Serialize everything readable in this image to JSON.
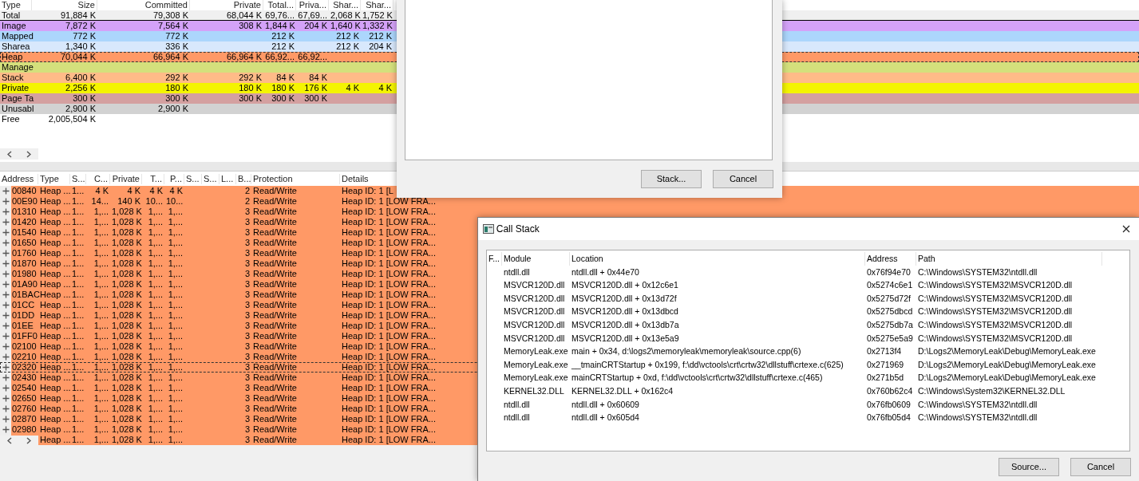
{
  "memory_summary": {
    "columns": [
      "Type",
      "Size",
      "Committed",
      "Private",
      "Total...",
      "Priva...",
      "Shar...",
      "Shar..."
    ],
    "rows": [
      {
        "cells": [
          "Total",
          "91,884 K",
          "79,308 K",
          "68,044 K",
          "69,76...",
          "67,69...",
          "2,068 K",
          "1,752 K"
        ],
        "color": "#f0f0f0",
        "focused": false
      },
      {
        "cells": [
          "Image",
          "7,872 K",
          "7,564 K",
          "308 K",
          "1,844 K",
          "204 K",
          "1,640 K",
          "1,332 K"
        ],
        "color": "#d4a2f8",
        "focused": false
      },
      {
        "cells": [
          "Mapped",
          "772 K",
          "772 K",
          null,
          "212 K",
          null,
          "212 K",
          "212 K"
        ],
        "color": "#acd6fc",
        "focused": false
      },
      {
        "cells": [
          "Sharea",
          "1,340 K",
          "336 K",
          null,
          "212 K",
          null,
          "212 K",
          "204 K"
        ],
        "color": "#d8e8fc",
        "focused": false
      },
      {
        "cells": [
          "Heap",
          "70,044 K",
          "66,964 K",
          "66,964 K",
          "66,92...",
          "66,92...",
          null,
          null
        ],
        "color": "#ff9966",
        "focused": true
      },
      {
        "cells": [
          "Manage",
          null,
          null,
          null,
          null,
          null,
          null,
          null
        ],
        "color": "#d4e07c",
        "focused": false
      },
      {
        "cells": [
          "Stack",
          "6,400 K",
          "292 K",
          "292 K",
          "84 K",
          "84 K",
          null,
          null
        ],
        "color": "#ffbb88",
        "focused": false
      },
      {
        "cells": [
          "Private",
          "2,256 K",
          "180 K",
          "180 K",
          "180 K",
          "176 K",
          "4 K",
          "4 K"
        ],
        "color": "#f4f400",
        "focused": false
      },
      {
        "cells": [
          "Page Ta",
          "300 K",
          "300 K",
          "300 K",
          "300 K",
          "300 K",
          null,
          null
        ],
        "color": "#d4a0a0",
        "focused": false
      },
      {
        "cells": [
          "Unusabl",
          "2,900 K",
          "2,900 K",
          null,
          null,
          null,
          null,
          null
        ],
        "color": "#d2d2d2",
        "focused": false
      },
      {
        "cells": [
          "Free",
          "2,005,504 K",
          null,
          null,
          null,
          null,
          null,
          null
        ],
        "color": "#ffffff",
        "focused": false
      }
    ]
  },
  "dialog": {
    "buttons": [
      "Stack...",
      "Cancel"
    ]
  },
  "regions": {
    "columns": [
      "Address",
      "Type",
      "S...",
      "C...",
      "Private",
      "T...",
      "P...",
      "S...",
      "S...",
      "L...",
      "B...",
      "Protection",
      "Details"
    ],
    "rows": [
      {
        "cells": [
          "00840",
          "Heap ...",
          "1...",
          "4 K",
          "4 K",
          "4 K",
          "4 K",
          null,
          null,
          null,
          "2",
          "Read/Write",
          "Heap ID: 1 [L"
        ],
        "focused": false
      },
      {
        "cells": [
          "00E90",
          "Heap ...",
          "1...",
          "14...",
          "140 K",
          "10...",
          "10...",
          null,
          null,
          null,
          "2",
          "Read/Write",
          "Heap ID: 1 [LOW FRA..."
        ],
        "focused": false
      },
      {
        "cells": [
          "01310",
          "Heap ...",
          "1...",
          "1,...",
          "1,028 K",
          "1,...",
          "1,...",
          null,
          null,
          null,
          "3",
          "Read/Write",
          "Heap ID: 1 [LOW FRA..."
        ],
        "focused": false
      },
      {
        "cells": [
          "01420",
          "Heap ...",
          "1...",
          "1,...",
          "1,028 K",
          "1,...",
          "1,...",
          null,
          null,
          null,
          "3",
          "Read/Write",
          "Heap ID: 1 [LOW FRA..."
        ],
        "focused": false
      },
      {
        "cells": [
          "01540",
          "Heap ...",
          "1...",
          "1,...",
          "1,028 K",
          "1,...",
          "1,...",
          null,
          null,
          null,
          "3",
          "Read/Write",
          "Heap ID: 1 [LOW FRA..."
        ],
        "focused": false
      },
      {
        "cells": [
          "01650",
          "Heap ...",
          "1...",
          "1,...",
          "1,028 K",
          "1,...",
          "1,...",
          null,
          null,
          null,
          "3",
          "Read/Write",
          "Heap ID: 1 [LOW FRA..."
        ],
        "focused": false
      },
      {
        "cells": [
          "01760",
          "Heap ...",
          "1...",
          "1,...",
          "1,028 K",
          "1,...",
          "1,...",
          null,
          null,
          null,
          "3",
          "Read/Write",
          "Heap ID: 1 [LOW FRA..."
        ],
        "focused": false
      },
      {
        "cells": [
          "01870",
          "Heap ...",
          "1...",
          "1,...",
          "1,028 K",
          "1,...",
          "1,...",
          null,
          null,
          null,
          "3",
          "Read/Write",
          "Heap ID: 1 [LOW FRA..."
        ],
        "focused": false
      },
      {
        "cells": [
          "01980",
          "Heap ...",
          "1...",
          "1,...",
          "1,028 K",
          "1,...",
          "1,...",
          null,
          null,
          null,
          "3",
          "Read/Write",
          "Heap ID: 1 [LOW FRA..."
        ],
        "focused": false
      },
      {
        "cells": [
          "01A90",
          "Heap ...",
          "1...",
          "1,...",
          "1,028 K",
          "1,...",
          "1,...",
          null,
          null,
          null,
          "3",
          "Read/Write",
          "Heap ID: 1 [LOW FRA..."
        ],
        "focused": false
      },
      {
        "cells": [
          "01BAC",
          "Heap ...",
          "1...",
          "1,...",
          "1,028 K",
          "1,...",
          "1,...",
          null,
          null,
          null,
          "3",
          "Read/Write",
          "Heap ID: 1 [LOW FRA..."
        ],
        "focused": false
      },
      {
        "cells": [
          "01CC",
          "Heap ...",
          "1...",
          "1,...",
          "1,028 K",
          "1,...",
          "1,...",
          null,
          null,
          null,
          "3",
          "Read/Write",
          "Heap ID: 1 [LOW FRA..."
        ],
        "focused": false
      },
      {
        "cells": [
          "01DD",
          "Heap ...",
          "1...",
          "1,...",
          "1,028 K",
          "1,...",
          "1,...",
          null,
          null,
          null,
          "3",
          "Read/Write",
          "Heap ID: 1 [LOW FRA..."
        ],
        "focused": false
      },
      {
        "cells": [
          "01EE",
          "Heap ...",
          "1...",
          "1,...",
          "1,028 K",
          "1,...",
          "1,...",
          null,
          null,
          null,
          "3",
          "Read/Write",
          "Heap ID: 1 [LOW FRA..."
        ],
        "focused": false
      },
      {
        "cells": [
          "01FF0",
          "Heap ...",
          "1...",
          "1,...",
          "1,028 K",
          "1,...",
          "1,...",
          null,
          null,
          null,
          "3",
          "Read/Write",
          "Heap ID: 1 [LOW FRA..."
        ],
        "focused": false
      },
      {
        "cells": [
          "02100",
          "Heap ...",
          "1...",
          "1,...",
          "1,028 K",
          "1,...",
          "1,...",
          null,
          null,
          null,
          "3",
          "Read/Write",
          "Heap ID: 1 [LOW FRA..."
        ],
        "focused": false
      },
      {
        "cells": [
          "02210",
          "Heap ...",
          "1...",
          "1,...",
          "1,028 K",
          "1,...",
          "1,...",
          null,
          null,
          null,
          "3",
          "Read/Write",
          "Heap ID: 1 [LOW FRA..."
        ],
        "focused": false
      },
      {
        "cells": [
          "02320",
          "Heap ...",
          "1...",
          "1,...",
          "1,028 K",
          "1,...",
          "1,...",
          null,
          null,
          null,
          "3",
          "Read/Write",
          "Heap ID: 1 [LOW FRA..."
        ],
        "focused": true
      },
      {
        "cells": [
          "02430",
          "Heap ...",
          "1...",
          "1,...",
          "1,028 K",
          "1,...",
          "1,...",
          null,
          null,
          null,
          "3",
          "Read/Write",
          "Heap ID: 1 [LOW FRA..."
        ],
        "focused": false
      },
      {
        "cells": [
          "02540",
          "Heap ...",
          "1...",
          "1,...",
          "1,028 K",
          "1,...",
          "1,...",
          null,
          null,
          null,
          "3",
          "Read/Write",
          "Heap ID: 1 [LOW FRA..."
        ],
        "focused": false
      },
      {
        "cells": [
          "02650",
          "Heap ...",
          "1...",
          "1,...",
          "1,028 K",
          "1,...",
          "1,...",
          null,
          null,
          null,
          "3",
          "Read/Write",
          "Heap ID: 1 [LOW FRA..."
        ],
        "focused": false
      },
      {
        "cells": [
          "02760",
          "Heap ...",
          "1...",
          "1,...",
          "1,028 K",
          "1,...",
          "1,...",
          null,
          null,
          null,
          "3",
          "Read/Write",
          "Heap ID: 1 [LOW FRA..."
        ],
        "focused": false
      },
      {
        "cells": [
          "02870",
          "Heap ...",
          "1...",
          "1,...",
          "1,028 K",
          "1,...",
          "1,...",
          null,
          null,
          null,
          "3",
          "Read/Write",
          "Heap ID: 1 [LOW FRA..."
        ],
        "focused": false
      },
      {
        "cells": [
          "02980",
          "Heap ...",
          "1...",
          "1,...",
          "1,028 K",
          "1,...",
          "1,...",
          null,
          null,
          null,
          "3",
          "Read/Write",
          "Heap ID: 1 [LOW FRA..."
        ],
        "focused": false
      },
      {
        "cells": [
          null,
          "Heap ...",
          "1...",
          "1,...",
          "1,028 K",
          "1,...",
          "1,...",
          null,
          null,
          null,
          "3",
          "Read/Write",
          "Heap ID: 1 [LOW FRA..."
        ],
        "focused": false
      }
    ]
  },
  "call_stack": {
    "title": "Call Stack",
    "columns": [
      "F...",
      "Module",
      "Location",
      "Address",
      "Path"
    ],
    "rows": [
      {
        "module": "ntdll.dll",
        "location": "ntdll.dll + 0x44e70",
        "address": "0x76f94e70",
        "path": "C:\\Windows\\SYSTEM32\\ntdll.dll"
      },
      {
        "module": "MSVCR120D.dll",
        "location": "MSVCR120D.dll + 0x12c6e1",
        "address": "0x5274c6e1",
        "path": "C:\\Windows\\SYSTEM32\\MSVCR120D.dll"
      },
      {
        "module": "MSVCR120D.dll",
        "location": "MSVCR120D.dll + 0x13d72f",
        "address": "0x5275d72f",
        "path": "C:\\Windows\\SYSTEM32\\MSVCR120D.dll"
      },
      {
        "module": "MSVCR120D.dll",
        "location": "MSVCR120D.dll + 0x13dbcd",
        "address": "0x5275dbcd",
        "path": "C:\\Windows\\SYSTEM32\\MSVCR120D.dll"
      },
      {
        "module": "MSVCR120D.dll",
        "location": "MSVCR120D.dll + 0x13db7a",
        "address": "0x5275db7a",
        "path": "C:\\Windows\\SYSTEM32\\MSVCR120D.dll"
      },
      {
        "module": "MSVCR120D.dll",
        "location": "MSVCR120D.dll + 0x13e5a9",
        "address": "0x5275e5a9",
        "path": "C:\\Windows\\SYSTEM32\\MSVCR120D.dll"
      },
      {
        "module": "MemoryLeak.exe",
        "location": "main + 0x34, d:\\logs2\\memoryleak\\memoryleak\\source.cpp(6)",
        "address": "0x2713f4",
        "path": "D:\\Logs2\\MemoryLeak\\Debug\\MemoryLeak.exe"
      },
      {
        "module": "MemoryLeak.exe",
        "location": "__tmainCRTStartup + 0x199, f:\\dd\\vctools\\crt\\crtw32\\dllstuff\\crtexe.c(625)",
        "address": "0x271969",
        "path": "D:\\Logs2\\MemoryLeak\\Debug\\MemoryLeak.exe"
      },
      {
        "module": "MemoryLeak.exe",
        "location": "mainCRTStartup + 0xd, f:\\dd\\vctools\\crt\\crtw32\\dllstuff\\crtexe.c(465)",
        "address": "0x271b5d",
        "path": "D:\\Logs2\\MemoryLeak\\Debug\\MemoryLeak.exe"
      },
      {
        "module": "KERNEL32.DLL",
        "location": "KERNEL32.DLL + 0x162c4",
        "address": "0x760b62c4",
        "path": "C:\\Windows\\System32\\KERNEL32.DLL"
      },
      {
        "module": "ntdll.dll",
        "location": "ntdll.dll + 0x60609",
        "address": "0x76fb0609",
        "path": "C:\\Windows\\SYSTEM32\\ntdll.dll"
      },
      {
        "module": "ntdll.dll",
        "location": "ntdll.dll + 0x605d4",
        "address": "0x76fb05d4",
        "path": "C:\\Windows\\SYSTEM32\\ntdll.dll"
      }
    ],
    "buttons": [
      "Source...",
      "Cancel"
    ]
  }
}
